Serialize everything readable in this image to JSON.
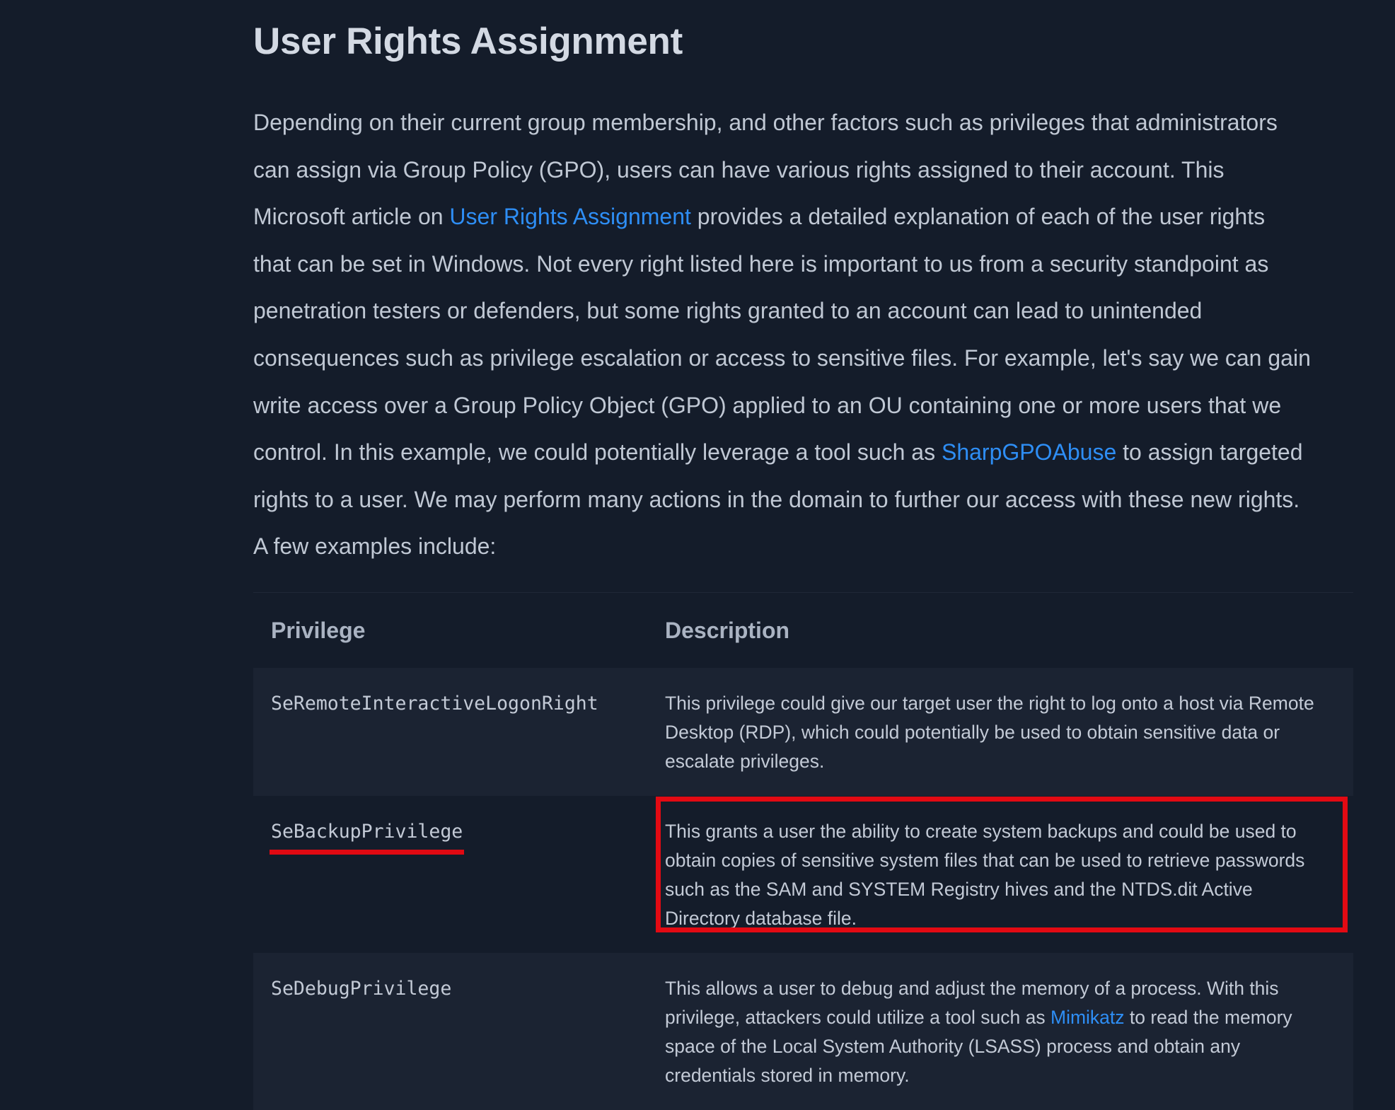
{
  "page": {
    "title": "User Rights Assignment"
  },
  "intro": {
    "lines": [
      {
        "before": "Depending on their current group membership, and other factors such as privileges that administrators"
      },
      {
        "before": "can assign via Group Policy (GPO), users can have various rights assigned to their account. This"
      },
      {
        "before": "Microsoft article on ",
        "link": "User Rights Assignment",
        "after": " provides a detailed explanation of each of the user rights"
      },
      {
        "before": "that can be set in Windows. Not every right listed here is important to us from a security standpoint as"
      },
      {
        "before": "penetration testers or defenders, but some rights granted to an account can lead to unintended"
      },
      {
        "before": "consequences such as privilege escalation or access to sensitive files. For example, let's say we can gain"
      },
      {
        "before": "write access over a Group Policy Object (GPO) applied to an OU containing one or more users that we"
      },
      {
        "before": "control. In this example, we could potentially leverage a tool such as ",
        "link": "SharpGPOAbuse",
        "after": " to assign targeted"
      },
      {
        "before": "rights to a user. We may perform many actions in the domain to further our access with these new rights."
      },
      {
        "before": "A few examples include:"
      }
    ]
  },
  "table": {
    "headers": {
      "privilege": "Privilege",
      "description": "Description"
    },
    "rows": [
      {
        "privilege": "SeRemoteInteractiveLogonRight",
        "desc_lines": [
          {
            "before": "This privilege could give our target user the right to log onto a host via Remote"
          },
          {
            "before": "Desktop (RDP), which could potentially be used to obtain sensitive data or"
          },
          {
            "before": "escalate privileges."
          }
        ]
      },
      {
        "privilege": "SeBackupPrivilege",
        "desc_lines": [
          {
            "before": "This grants a user the ability to create system backups and could be used to"
          },
          {
            "before": "obtain copies of sensitive system files that can be used to retrieve passwords"
          },
          {
            "before": "such as the SAM and SYSTEM Registry hives and the NTDS.dit Active"
          },
          {
            "before": "Directory database file."
          }
        ]
      },
      {
        "privilege": "SeDebugPrivilege",
        "desc_lines": [
          {
            "before": "This allows a user to debug and adjust the memory of a process. With this"
          },
          {
            "before": "privilege, attackers could utilize a tool such as ",
            "link": "Mimikatz",
            "after": " to read the memory"
          },
          {
            "before": "space of the Local System Authority (LSASS) process and obtain any"
          },
          {
            "before": "credentials stored in memory."
          }
        ]
      }
    ]
  },
  "colors": {
    "background": "#141c2a",
    "link": "#2e8ef5",
    "privilege_text": "#9fe516",
    "annotation_red": "#e30a13"
  }
}
